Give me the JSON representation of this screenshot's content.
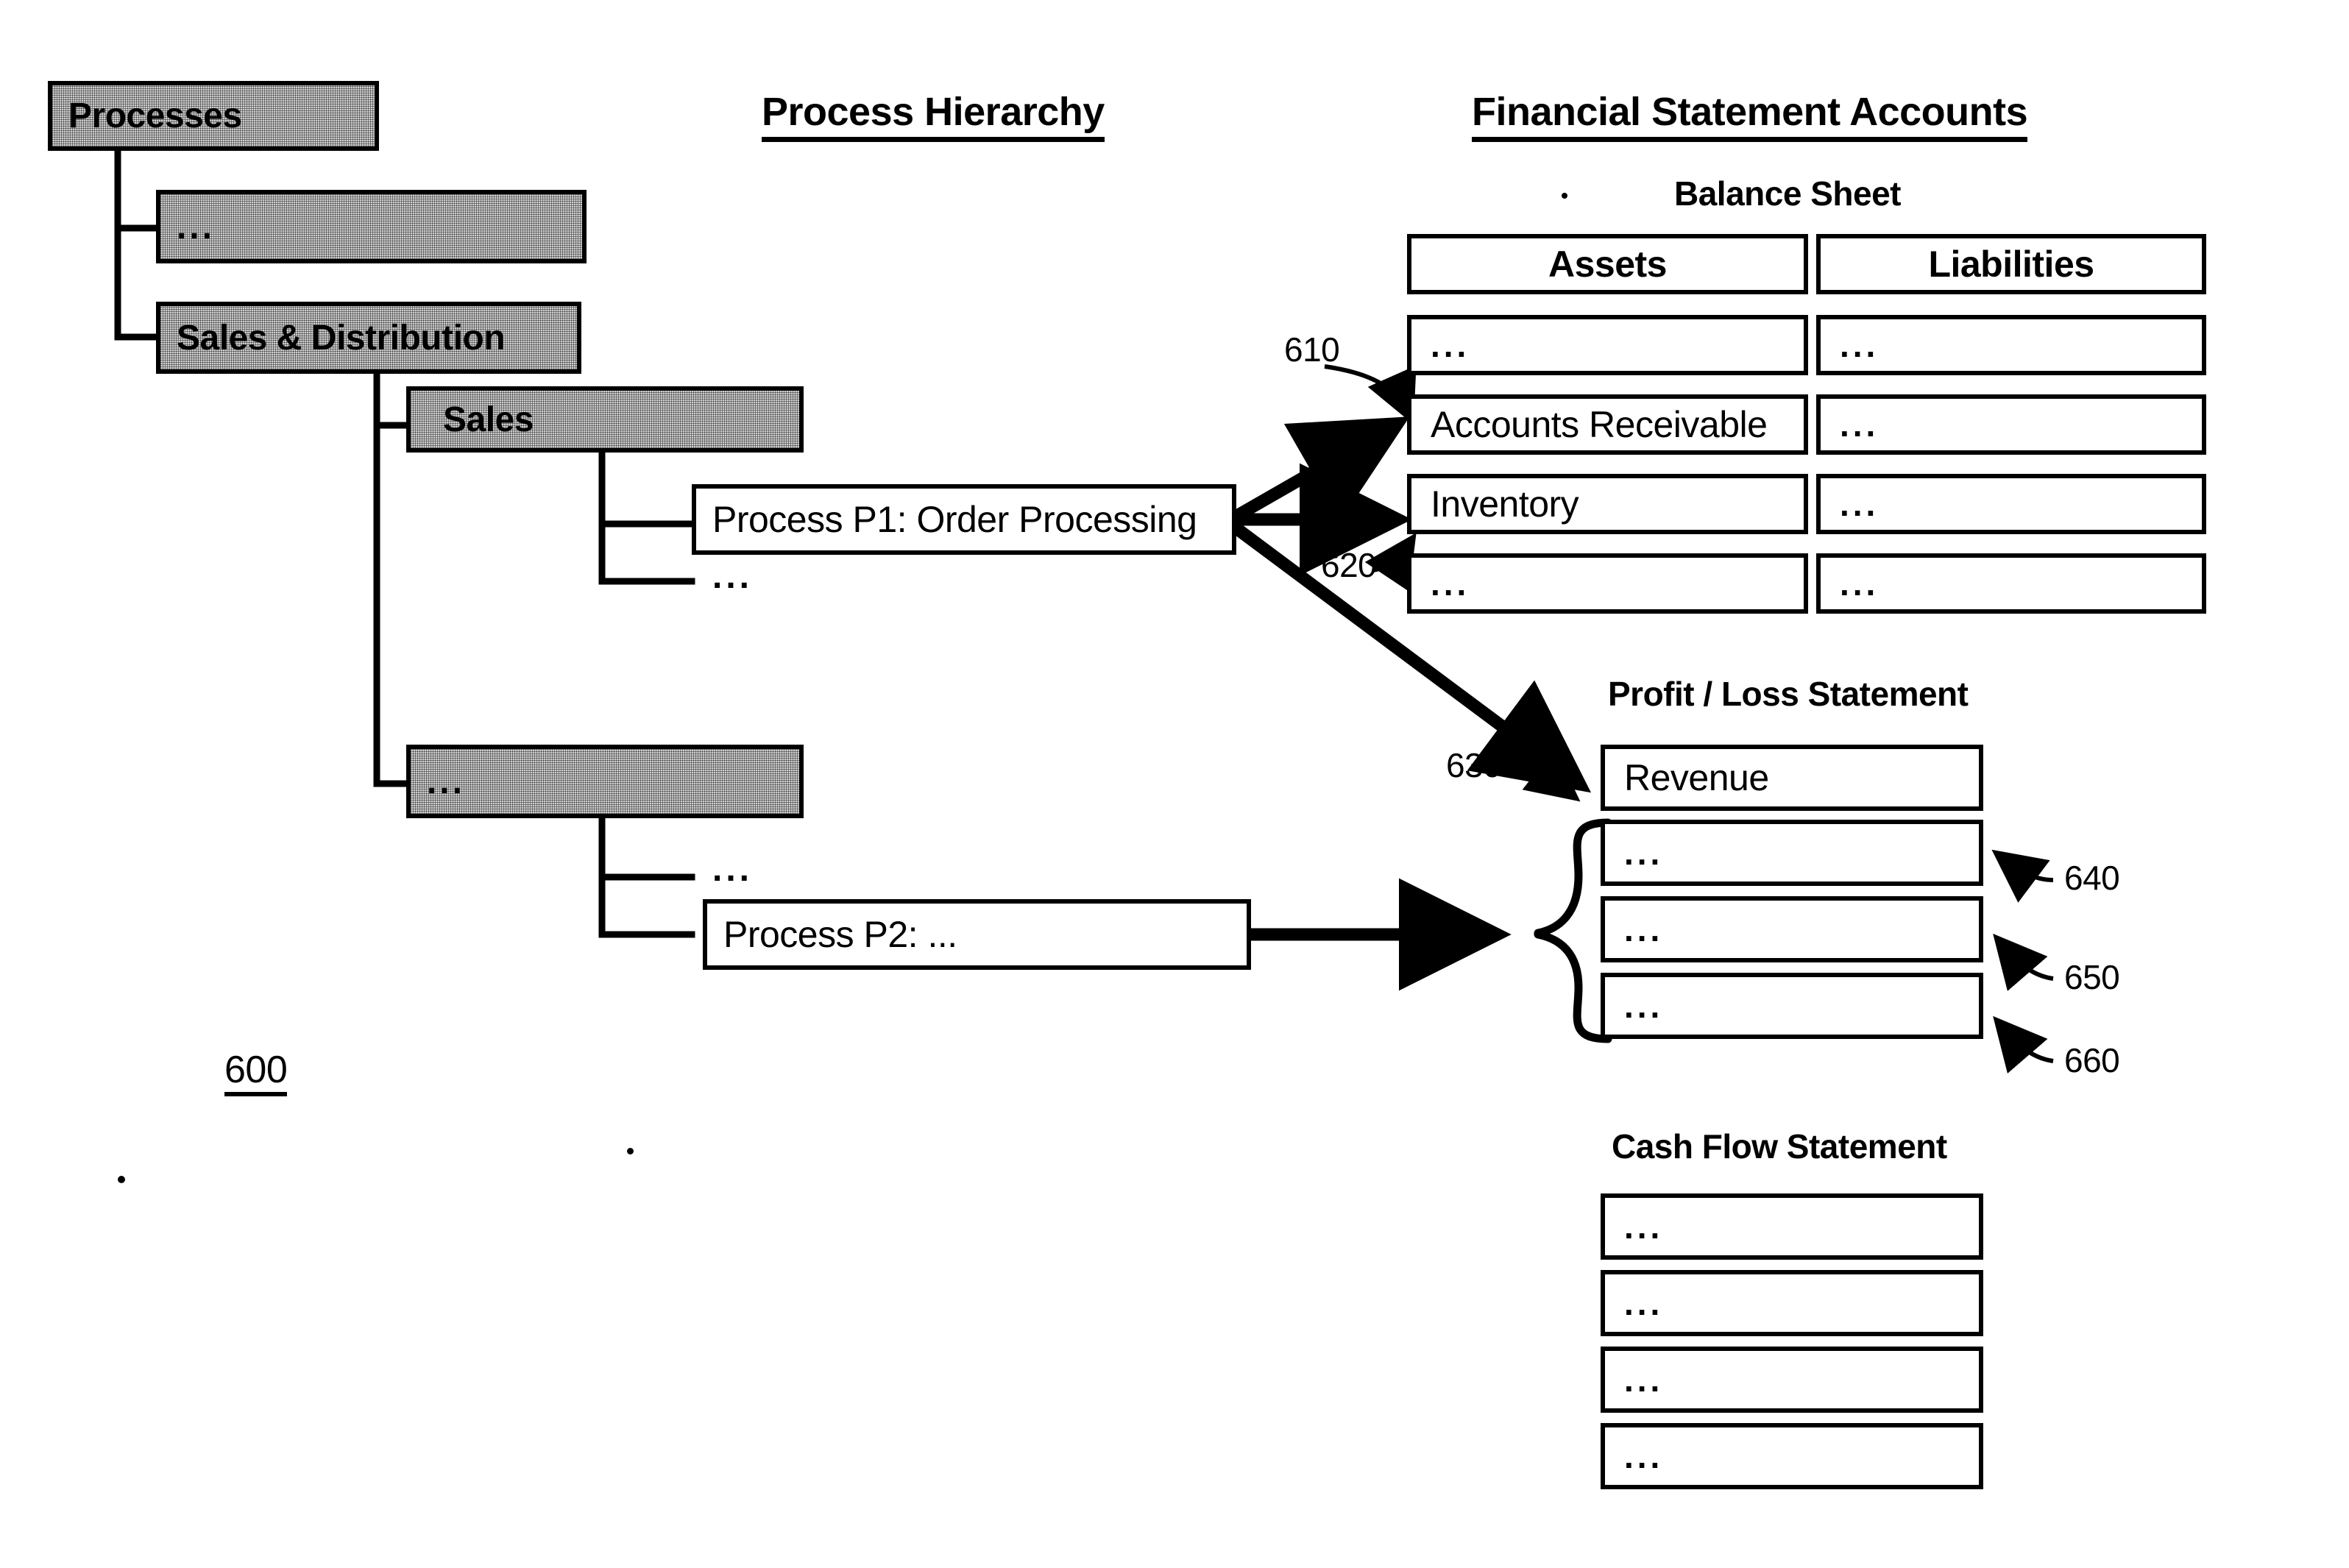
{
  "figure": {
    "number": "600"
  },
  "headings": {
    "process_hierarchy": "Process Hierarchy",
    "financial_statement_accounts": "Financial Statement Accounts",
    "balance_sheet": "Balance Sheet",
    "profit_loss_statement": "Profit / Loss Statement",
    "cash_flow_statement": "Cash Flow Statement"
  },
  "process_hierarchy": {
    "nodes": [
      {
        "label": "Processes",
        "style": "shaded",
        "level": 0
      },
      {
        "label": "...",
        "style": "shaded",
        "level": 1
      },
      {
        "label": "Sales & Distribution",
        "style": "shaded",
        "level": 1
      },
      {
        "label": "Sales",
        "style": "shaded",
        "level": 2
      },
      {
        "label": "Process P1: Order Processing",
        "style": "plain",
        "level": 3
      },
      {
        "label": "...",
        "style": "shaded",
        "level": 2
      },
      {
        "label": "Process P2: ...",
        "style": "plain",
        "level": 3
      }
    ],
    "inline_ellipses": [
      "...",
      "...",
      "..."
    ]
  },
  "balance_sheet": {
    "columns": [
      {
        "header": "Assets",
        "rows": [
          "...",
          "Accounts Receivable",
          "Inventory",
          "..."
        ]
      },
      {
        "header": "Liabilities",
        "rows": [
          "...",
          "...",
          "...",
          "..."
        ]
      }
    ]
  },
  "profit_loss": {
    "rows": [
      "Revenue",
      "...",
      "...",
      "..."
    ]
  },
  "cash_flow": {
    "rows": [
      "...",
      "...",
      "...",
      "..."
    ]
  },
  "reference_numerals": {
    "n610": "610",
    "n620": "620",
    "n630": "630",
    "n640": "640",
    "n650": "650",
    "n660": "660"
  },
  "colors": {
    "ink": "#000000",
    "paper": "#ffffff",
    "shade": "#cfcfcf"
  }
}
